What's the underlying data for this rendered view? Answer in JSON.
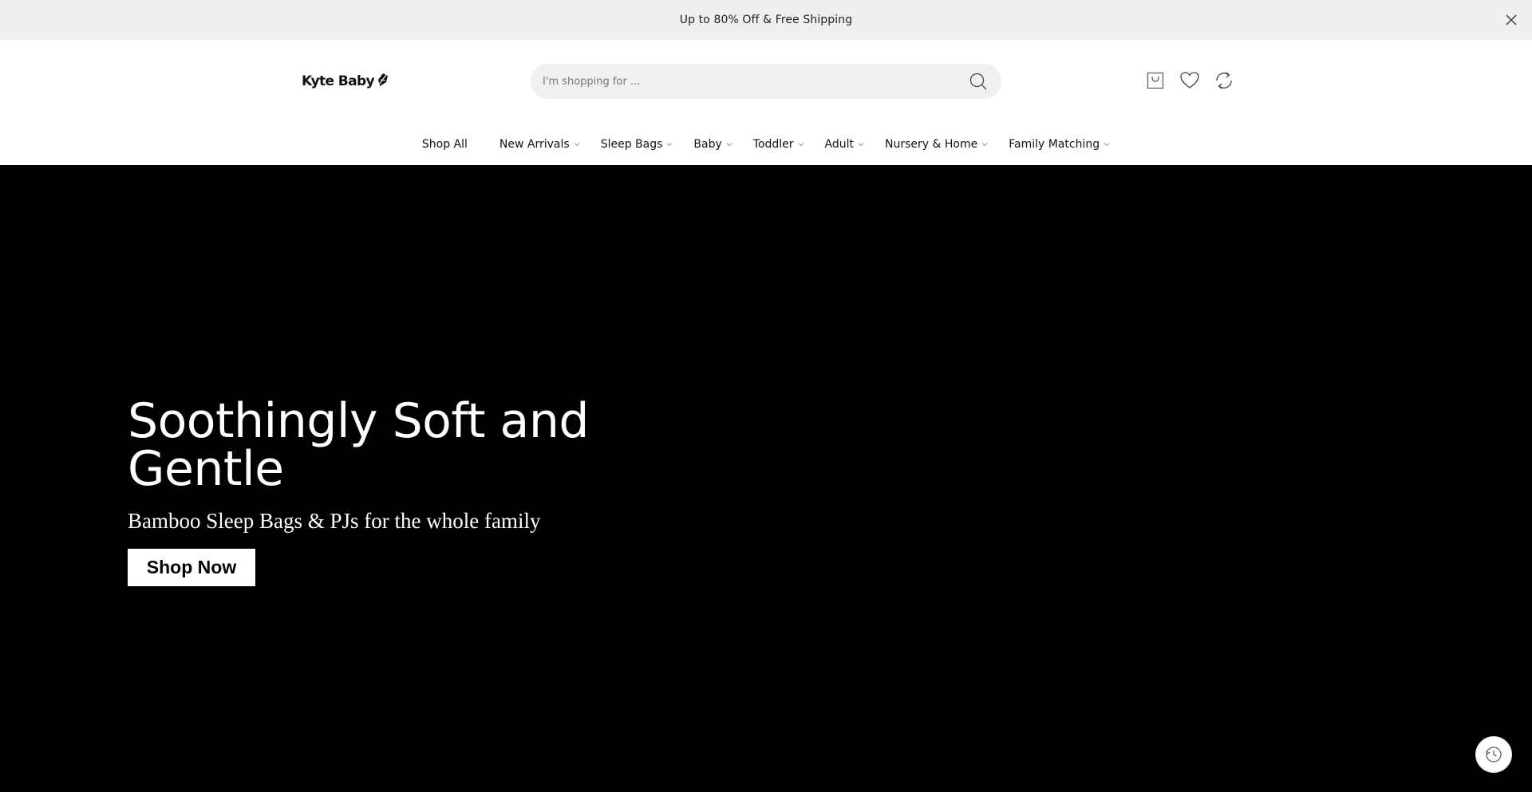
{
  "announcement": {
    "text": "Up to 80% Off & Free Shipping",
    "close_icon": "close-icon"
  },
  "header": {
    "logo_text": "Kyte Baby",
    "logo_icon": "leaf-logo-icon",
    "search": {
      "placeholder": "I'm shopping for ...",
      "value": "",
      "icon": "search-icon"
    },
    "icons": [
      "cart-icon",
      "heart-icon",
      "compare-icon"
    ]
  },
  "nav": {
    "items": [
      {
        "label": "Shop All",
        "has_dropdown": false
      },
      {
        "label": "New Arrivals",
        "has_dropdown": true
      },
      {
        "label": "Sleep Bags",
        "has_dropdown": true
      },
      {
        "label": "Baby",
        "has_dropdown": true
      },
      {
        "label": "Toddler",
        "has_dropdown": true
      },
      {
        "label": "Adult",
        "has_dropdown": true
      },
      {
        "label": "Nursery & Home",
        "has_dropdown": true
      },
      {
        "label": "Family Matching",
        "has_dropdown": true
      }
    ]
  },
  "hero": {
    "title": "Soothingly Soft and Gentle",
    "subtitle": "Bamboo Sleep Bags & PJs for the whole family",
    "cta_label": "Shop Now",
    "background_color": "#000000"
  },
  "floating": {
    "history_icon": "history-clock-icon"
  }
}
